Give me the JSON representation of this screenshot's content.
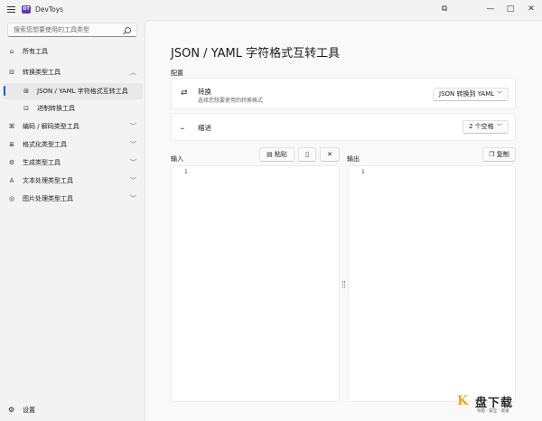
{
  "window": {
    "title": "DevToys",
    "app_icon_text": "DT"
  },
  "titlebar": {
    "snap_icon": "⧉",
    "minimize": "—",
    "maximize": "□",
    "close": "✕"
  },
  "search": {
    "placeholder": "搜索您想要使用的工具类型"
  },
  "sidebar": {
    "all_tools": "所有工具",
    "items": [
      {
        "label": "转换类型工具",
        "icon": "convert-icon",
        "chevron": "︿"
      },
      {
        "label": "JSON / YAML 字符格式互转工具",
        "icon": "json-yaml-icon"
      },
      {
        "label": "进制转换工具",
        "icon": "number-base-icon"
      },
      {
        "label": "编码 / 解码类型工具",
        "icon": "encode-icon",
        "chevron": "﹀"
      },
      {
        "label": "格式化类型工具",
        "icon": "format-icon",
        "chevron": "﹀"
      },
      {
        "label": "生成类型工具",
        "icon": "generate-icon",
        "chevron": "﹀"
      },
      {
        "label": "文本处理类型工具",
        "icon": "text-icon",
        "chevron": "﹀"
      },
      {
        "label": "图片处理类型工具",
        "icon": "image-icon",
        "chevron": "﹀"
      }
    ],
    "settings": "设置"
  },
  "main": {
    "title": "JSON / YAML 字符格式互转工具",
    "config_label": "配置",
    "conversion": {
      "title": "转换",
      "description": "选择您想要使用的转换格式",
      "value": "JSON 转换到 YAML"
    },
    "indent": {
      "title": "缩进",
      "value": "2 个空格"
    },
    "input": {
      "label": "输入",
      "paste": "粘贴",
      "line_numbers": "1"
    },
    "output": {
      "label": "输出",
      "copy": "复制",
      "line_numbers": "1"
    }
  },
  "watermark": {
    "brand": "盘下载",
    "slogan": "导航 · 安全 · 高速"
  }
}
